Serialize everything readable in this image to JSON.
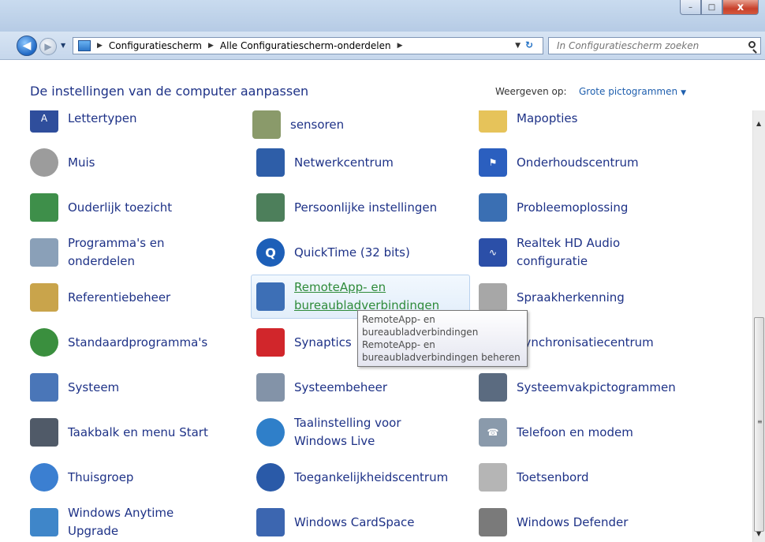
{
  "window": {
    "controls": {
      "minimize": "–",
      "maximize": "□",
      "close": "x"
    }
  },
  "nav": {
    "back_glyph": "◀",
    "forward_glyph": "▶",
    "breadcrumbs": [
      "Configuratiescherm",
      "Alle Configuratiescherm-onderdelen"
    ],
    "search_placeholder": "In Configuratiescherm zoeken"
  },
  "header": {
    "title": "De instellingen van de computer aanpassen",
    "view_label": "Weergeven op:",
    "view_value": "Grote pictogrammen"
  },
  "items": {
    "row0": [
      "Lettertypen",
      "sensoren",
      "Mapopties"
    ],
    "row1": [
      "Muis",
      "Netwerkcentrum",
      "Onderhoudscentrum"
    ],
    "row2": [
      "Ouderlijk toezicht",
      "Persoonlijke instellingen",
      "Probleemoplossing"
    ],
    "row3": [
      "Programma's en\nonderdelen",
      "QuickTime (32 bits)",
      "Realtek HD Audio\nconfiguratie"
    ],
    "row4": [
      "Referentiebeheer",
      "RemoteApp- en\nbureaubladverbindingen",
      "Spraakherkenning"
    ],
    "row5": [
      "Standaardprogramma's",
      "Synaptics",
      "Synchronisatiecentrum"
    ],
    "row6": [
      "Systeem",
      "Systeembeheer",
      "Systeemvakpictogrammen"
    ],
    "row7": [
      "Taakbalk en menu Start",
      "Taalinstelling voor\nWindows Live",
      "Telefoon en modem"
    ],
    "row8": [
      "Thuisgroep",
      "Toegankelijkheidscentrum",
      "Toetsenbord"
    ],
    "row9": [
      "Windows Anytime\nUpgrade",
      "Windows CardSpace",
      "Windows Defender"
    ]
  },
  "tooltip": "RemoteApp- en\nbureaubladverbindingen\nRemoteApp- en\nbureaubladverbindingen beheren",
  "colors": {
    "link": "#1e3287",
    "accent": "#1f5fae"
  }
}
